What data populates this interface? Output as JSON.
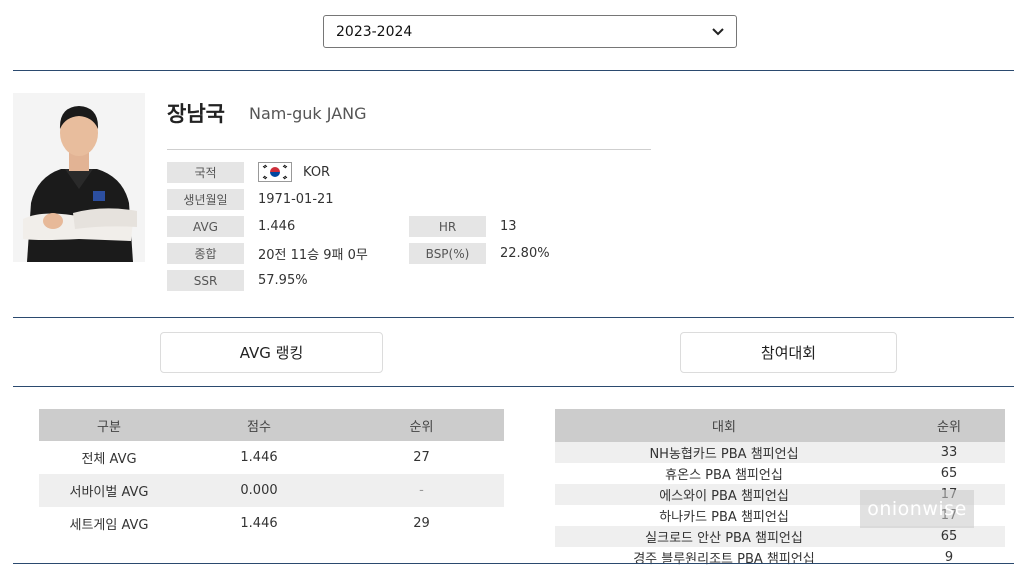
{
  "season": {
    "selected": "2023-2024"
  },
  "player": {
    "name_ko": "장남국",
    "name_en": "Nam-guk JANG",
    "photo_alt": "player-photo"
  },
  "profile": {
    "nationality_label": "국적",
    "nationality_value": "KOR",
    "birth_label": "생년월일",
    "birth_value": "1971-01-21",
    "avg_label": "AVG",
    "avg_value": "1.446",
    "hr_label": "HR",
    "hr_value": "13",
    "record_label": "종합",
    "record_value": "20전 11승 9패 0무",
    "bsp_label": "BSP(%)",
    "bsp_value": "22.80%",
    "ssr_label": "SSR",
    "ssr_value": "57.95%"
  },
  "tabs": {
    "avg_ranking": "AVG 랭킹",
    "tournaments": "참여대회"
  },
  "avg_table": {
    "headers": [
      "구분",
      "점수",
      "순위"
    ],
    "rows": [
      [
        "전체 AVG",
        "1.446",
        "27"
      ],
      [
        "서바이벌 AVG",
        "0.000",
        "-"
      ],
      [
        "세트게임 AVG",
        "1.446",
        "29"
      ]
    ]
  },
  "tournament_table": {
    "headers": [
      "대회",
      "순위"
    ],
    "rows": [
      [
        "NH농협카드 PBA 챔피언십",
        "33"
      ],
      [
        "휴온스 PBA 챔피언십",
        "65"
      ],
      [
        "에스와이 PBA 챔피언십",
        "17"
      ],
      [
        "하나카드 PBA 챔피언십",
        "17"
      ],
      [
        "실크로드 안산 PBA 챔피언십",
        "65"
      ],
      [
        "경주 블루원리조트 PBA 챔피언십",
        "9"
      ]
    ]
  },
  "watermark": "onionwise",
  "colors": {
    "rule": "#2b4a6f",
    "label_bg": "#e5e5e5",
    "header_bg": "#cccccc"
  }
}
